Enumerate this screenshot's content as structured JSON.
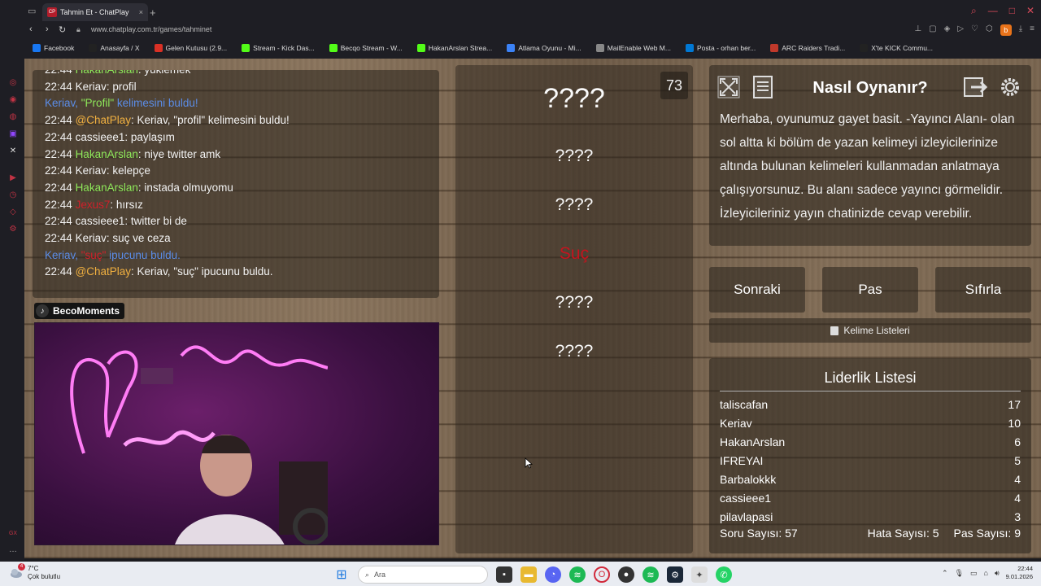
{
  "browser": {
    "tab_title": "Tahmin Et - ChatPlay",
    "tab_favicon_text": "CP",
    "url": "www.chatplay.com.tr/games/tahminet",
    "profile_letter": "b",
    "bookmarks": [
      {
        "label": "Facebook",
        "color": "#1877f2",
        "icon": "facebook-icon"
      },
      {
        "label": "Anasayfa / X",
        "color": "#222222",
        "icon": "x-icon"
      },
      {
        "label": "Gelen Kutusu (2.9...",
        "color": "#d93025",
        "icon": "gmail-icon"
      },
      {
        "label": "Stream - Kick Das...",
        "color": "#53fc18",
        "icon": "kick-icon"
      },
      {
        "label": "Becqo Stream - W...",
        "color": "#53fc18",
        "icon": "kick-icon"
      },
      {
        "label": "HakanArslan Strea...",
        "color": "#53fc18",
        "icon": "kick-icon"
      },
      {
        "label": "Atlama Oyunu - Mi...",
        "color": "#3b82f6",
        "icon": "game-icon"
      },
      {
        "label": "MailEnable Web M...",
        "color": "#888888",
        "icon": "mail-icon"
      },
      {
        "label": "Posta - orhan ber...",
        "color": "#0078d4",
        "icon": "outlook-icon"
      },
      {
        "label": "ARC Raiders Tradi...",
        "color": "#c0392b",
        "icon": "arc-icon"
      },
      {
        "label": "X'te KICK Commu...",
        "color": "#222222",
        "icon": "x-icon"
      }
    ]
  },
  "chat": {
    "lines": [
      {
        "time": "22:44",
        "user": "HakanArslan",
        "ucls": "u-green",
        "text": ": yüklemek"
      },
      {
        "time": "22:44",
        "user": "Keriav",
        "ucls": "",
        "text": ": profil"
      },
      {
        "time": "",
        "user": "Keriav, ",
        "ucls": "u-blue",
        "quote": "\"Profil\"",
        "qcls": "u-green",
        "text": " kelimesini buldu!",
        "tcls": "u-blue"
      },
      {
        "time": "22:44",
        "user": "@ChatPlay",
        "ucls": "u-gold",
        "text": ": Keriav, \"profil\" kelimesini buldu!"
      },
      {
        "time": "22:44",
        "user": "cassieee1",
        "ucls": "",
        "text": ": paylaşım"
      },
      {
        "time": "22:44",
        "user": "HakanArslan",
        "ucls": "u-green",
        "text": ": niye twitter amk"
      },
      {
        "time": "22:44",
        "user": "Keriav",
        "ucls": "",
        "text": ": kelepçe"
      },
      {
        "time": "22:44",
        "user": "HakanArslan",
        "ucls": "u-green",
        "text": ": instada olmuyomu"
      },
      {
        "time": "22:44",
        "user": "Jexus7",
        "ucls": "u-red",
        "text": ": hırsız"
      },
      {
        "time": "22:44",
        "user": "cassieee1",
        "ucls": "",
        "text": ": twitter bi de"
      },
      {
        "time": "22:44",
        "user": "Keriav",
        "ucls": "",
        "text": ": suç ve ceza"
      },
      {
        "time": "",
        "user": "Keriav, ",
        "ucls": "u-blue",
        "quote": "\"suç\"",
        "qcls": "u-red",
        "text": " ipucunu buldu.",
        "tcls": "u-blue"
      },
      {
        "time": "22:44",
        "user": "@ChatPlay",
        "ucls": "u-gold",
        "text": ": Keriav, \"suç\" ipucunu buldu."
      }
    ]
  },
  "camera": {
    "channel_name": "BecoMoments"
  },
  "words": {
    "counter": "73",
    "items": [
      {
        "text": "????",
        "cls": "big"
      },
      {
        "text": "????",
        "cls": ""
      },
      {
        "text": "????",
        "cls": ""
      },
      {
        "text": "Suç",
        "cls": "red"
      },
      {
        "text": "????",
        "cls": ""
      },
      {
        "text": "????",
        "cls": ""
      }
    ]
  },
  "how_to": {
    "title": "Nasıl Oynanır?",
    "text": "Merhaba, oyunumuz gayet basit. -Yayıncı Alanı- olan sol altta ki bölüm de yazan kelimeyi izleyicilerinize altında bulunan kelimeleri kullanmadan anlatmaya çalışıyorsunuz. Bu alanı sadece yayıncı görmelidir. İzleyicileriniz yayın chatinizde cevap verebilir."
  },
  "buttons": {
    "next": "Sonraki",
    "pass": "Pas",
    "reset": "Sıfırla",
    "word_lists": "Kelime Listeleri"
  },
  "leaderboard": {
    "title": "Liderlik Listesi",
    "rows": [
      {
        "name": "taliscafan",
        "score": "17"
      },
      {
        "name": "Keriav",
        "score": "10"
      },
      {
        "name": "HakanArslan",
        "score": "6"
      },
      {
        "name": "IFREYAI",
        "score": "5"
      },
      {
        "name": "Barbalokkk",
        "score": "4"
      },
      {
        "name": "cassieee1",
        "score": "4"
      },
      {
        "name": "pilavlapasi",
        "score": "3"
      }
    ],
    "question_count": "Soru Sayısı: 57",
    "error_count": "Hata Sayısı: 5",
    "pass_count": "Pas Sayısı: 9"
  },
  "taskbar": {
    "temperature": "7°C",
    "weather": "Çok bulutlu",
    "weather_badge": "4",
    "search_placeholder": "Ara",
    "time": "22:44",
    "date": "9.01.2026"
  }
}
